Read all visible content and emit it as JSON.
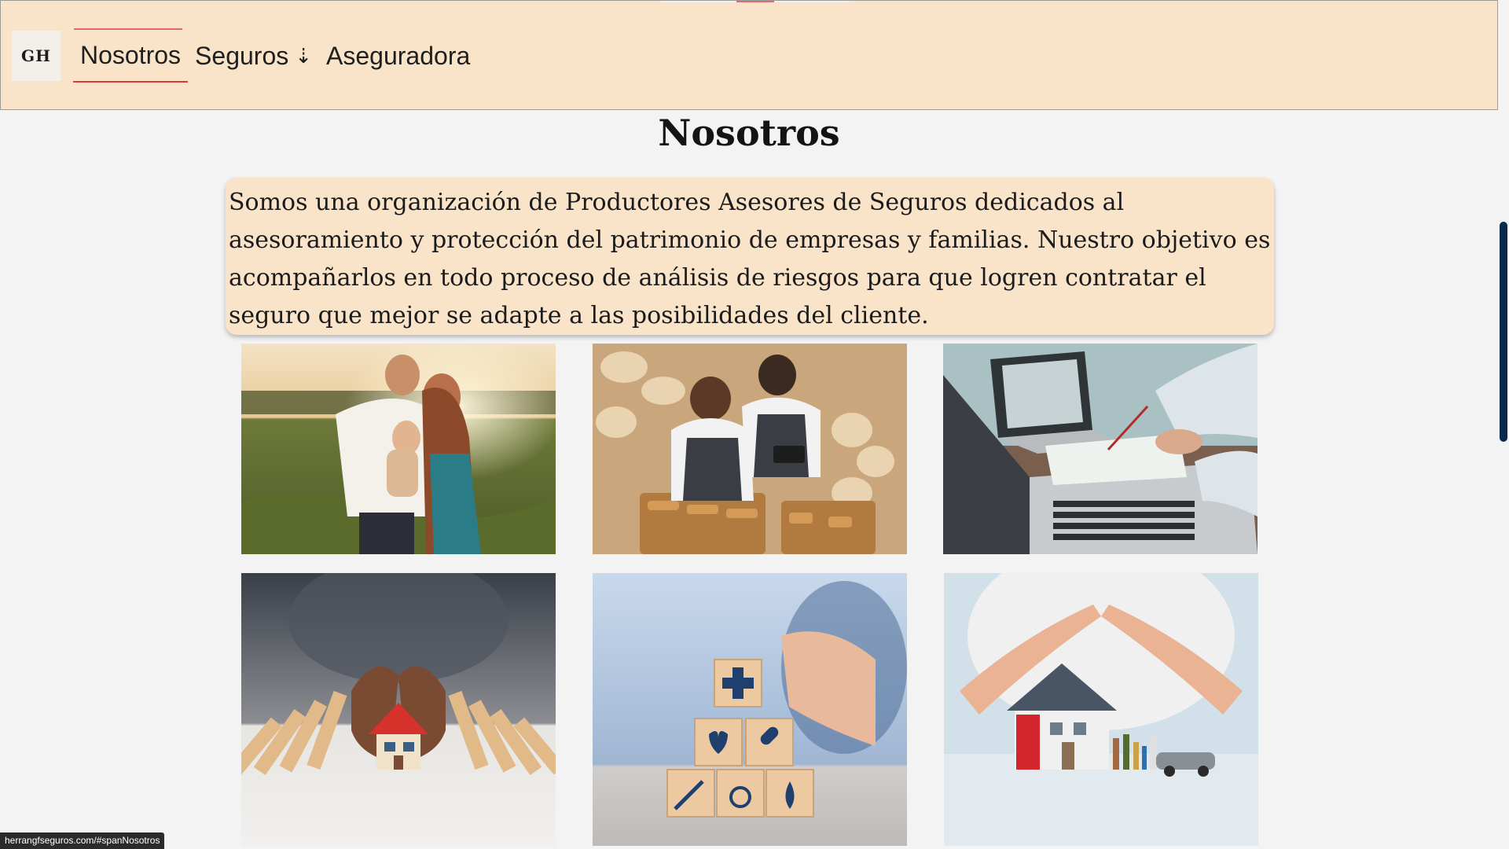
{
  "header": {
    "logo_text": "GH",
    "nav": [
      {
        "label": "Nosotros",
        "active": true
      },
      {
        "label": "Seguros",
        "icon": "arrow-down-icon"
      },
      {
        "label": "Aseguradora"
      }
    ],
    "dropdown_arrow": "⇣"
  },
  "main": {
    "title": "Nosotros",
    "intro": "Somos una organización de Productores Asesores de Seguros dedicados al asesoramiento y protección del patrimonio de empresas y familias. Nuestro objetivo es acompañarlos en todo proceso de análisis de riesgos para que logren contratar el seguro que mejor se adapte a las posibilidades del cliente."
  },
  "photos": [
    {
      "subject": "family-in-field"
    },
    {
      "subject": "bakery-workers"
    },
    {
      "subject": "laptop-documents"
    },
    {
      "subject": "house-protected-from-dominoes"
    },
    {
      "subject": "health-insurance-blocks"
    },
    {
      "subject": "hands-over-house-and-family"
    }
  ],
  "status_bar": {
    "url": "herrangfseguros.com/#spanNosotros"
  },
  "colors": {
    "header_bg": "#f9e4c9",
    "accent": "#e03a3a",
    "page_bg": "#f3f3f3",
    "scrollbar": "#0c2a4d"
  }
}
